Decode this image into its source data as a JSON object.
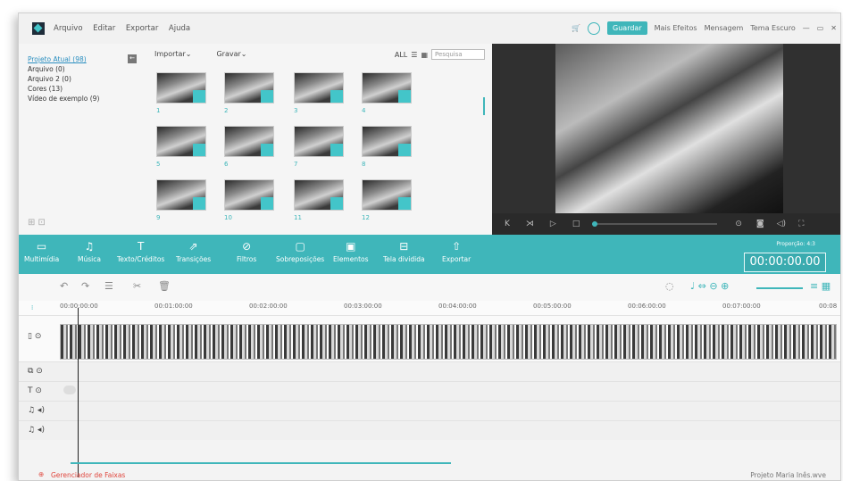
{
  "menu": {
    "items": [
      "Arquivo",
      "Editar",
      "Exportar",
      "Ajuda"
    ]
  },
  "topbar": {
    "save": "Guardar",
    "more_effects": "Mais Efeitos",
    "message": "Mensagem",
    "dark_theme": "Tema Escuro"
  },
  "library": {
    "items": [
      "Projeto Atual (98)",
      "Arquivo (0)",
      "Arquivo 2 (0)",
      "Cores (13)",
      "Vídeo de exemplo (9)"
    ]
  },
  "media": {
    "import": "Importar",
    "record": "Gravar",
    "all": "ALL",
    "search_placeholder": "Pesquisa",
    "thumb_numbers": [
      "1",
      "2",
      "3",
      "4",
      "5",
      "6",
      "7",
      "8",
      "9",
      "10",
      "11",
      "12"
    ]
  },
  "tabs": [
    "Multimídia",
    "Música",
    "Texto/Créditos",
    "Transições",
    "Filtros",
    "Sobreposições",
    "Elementos",
    "Tela dividida",
    "Exportar"
  ],
  "proportion": "Proporção: 4:3",
  "timecode": "00:00:00.00",
  "ruler": [
    "00:00:00:00",
    "00:01:00:00",
    "00:02:00:00",
    "00:03:00:00",
    "00:04:00:00",
    "00:05:00:00",
    "00:06:00:00",
    "00:07:00:00",
    "00:08"
  ],
  "status": {
    "left": "Gerenciador de Faixas",
    "right": "Projeto Maria Inês.wve"
  }
}
